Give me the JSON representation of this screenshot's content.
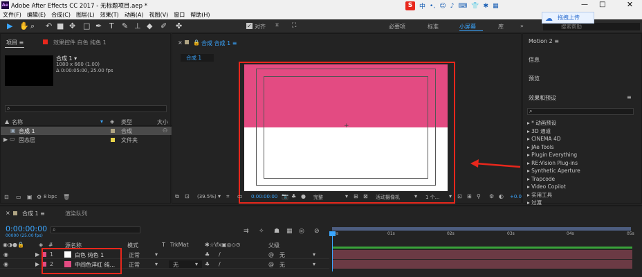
{
  "window": {
    "title": "Adobe After Effects CC 2017 - 无标题项目.aep *",
    "app_icon": "Ae"
  },
  "ime": {
    "logo": "S",
    "items": [
      "中",
      "•,",
      "☺",
      "♪",
      "⌨",
      "👕",
      "✱",
      "▦"
    ]
  },
  "menu": [
    "文件(F)",
    "编辑(E)",
    "合成(C)",
    "图层(L)",
    "效果(T)",
    "动画(A)",
    "视图(V)",
    "窗口",
    "帮助(H)"
  ],
  "toolbar": {
    "align_label": "对齐",
    "workspaces": [
      "必要项",
      "标准",
      "小屏幕",
      "库"
    ],
    "active_workspace": "小屏幕",
    "search_placeholder": "搜索帮助",
    "cloud_label": "拖拽上传"
  },
  "project": {
    "tab_label": "项目",
    "fx_tab_label": "效果控件 白色 纯色 1",
    "comp_name": "合成 1 ▾",
    "comp_size": "1080 x 660 (1.00)",
    "comp_duration": "Δ 0:00:05:00, 25.00 fps",
    "col_name": "名称",
    "col_type": "类型",
    "col_size": "大小",
    "items": [
      {
        "name": "合成 1",
        "type": "合成",
        "color": "#b0a584"
      },
      {
        "name": "固态层",
        "type": "文件夹",
        "color": "#e8d44a"
      }
    ],
    "bpc": "8 bpc"
  },
  "viewer": {
    "tab_label": "合成 合成 1",
    "comp_chip": "合成 1",
    "zoom": "(39.5%)",
    "timecode": "0:00:00:00",
    "quality": "完整",
    "camera": "活动摄像机",
    "views": "1 个...",
    "exposure": "+0.0",
    "colors": {
      "top": "#e34b82",
      "bottom": "#ffffff"
    }
  },
  "right_panel": {
    "tab_label": "Motion 2",
    "info": "信息",
    "preview": "预览",
    "effects_title": "效果和预设",
    "effects": [
      "* 动画预设",
      "3D 通道",
      "CINEMA 4D",
      "JAe Tools",
      "Plugin Everything",
      "RE:Vision Plug-ins",
      "Synthetic Aperture",
      "Trapcode",
      "Video Copilot",
      "实用工具",
      "过渡"
    ]
  },
  "timeline": {
    "tab_label": "合成 1",
    "render_tab": "渲染队列",
    "timecode": "0:00:00:00",
    "frames": "00000 (25.00 fps)",
    "headers": {
      "source": "源名称",
      "mode": "模式",
      "t": "T",
      "trkmat": "TrkMat",
      "parent": "父级"
    },
    "layers": [
      {
        "num": "1",
        "name": "白色 纯色 1",
        "mode": "正常",
        "trkmat": "",
        "parent": "无",
        "color": "#ffffff",
        "label": "#e34b82"
      },
      {
        "num": "2",
        "name": "中间色洋红 纯...",
        "mode": "正常",
        "trkmat": "无",
        "parent": "无",
        "color": "#e34b82",
        "label": "#e34b82"
      }
    ],
    "ruler": [
      "0s",
      "01s",
      "02s",
      "03s",
      "04s",
      "05s"
    ]
  }
}
